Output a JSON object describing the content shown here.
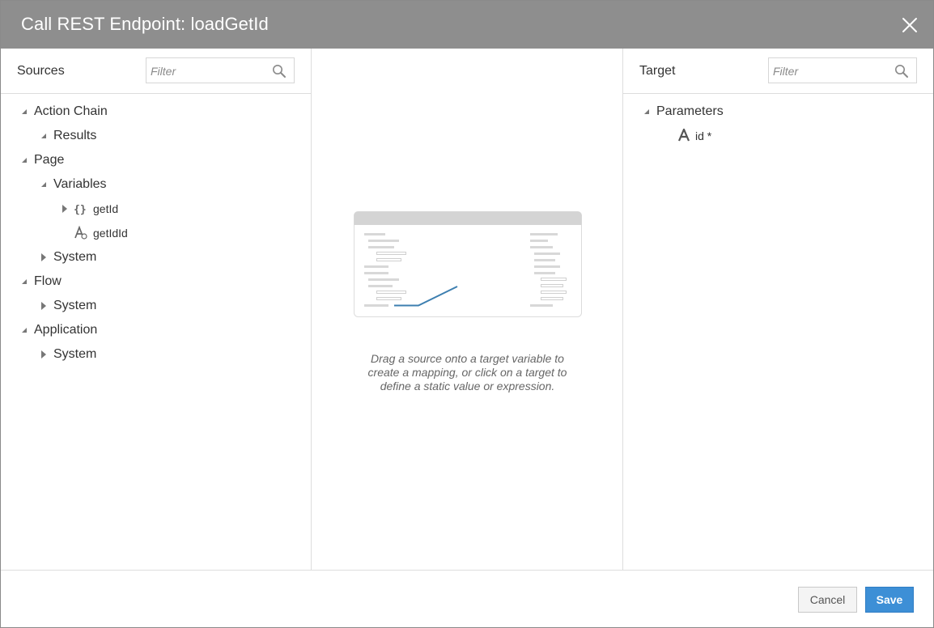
{
  "dialog": {
    "title": "Call REST Endpoint: loadGetId"
  },
  "icons": {
    "close": "close-icon",
    "search": "search-icon",
    "expanded": "triangle-down-icon",
    "collapsed": "triangle-right-icon",
    "object": "curly-braces-icon",
    "string": "string-type-icon"
  },
  "sources": {
    "title": "Sources",
    "filter_placeholder": "Filter",
    "tree": [
      {
        "label": "Action Chain",
        "state": "expanded"
      },
      {
        "label": "Results",
        "state": "expanded"
      },
      {
        "label": "Page",
        "state": "expanded"
      },
      {
        "label": "Variables",
        "state": "expanded"
      },
      {
        "label": "getId",
        "state": "collapsed",
        "type": "object"
      },
      {
        "label": "getIdId",
        "type": "string"
      },
      {
        "label": "System",
        "state": "collapsed"
      },
      {
        "label": "Flow",
        "state": "expanded"
      },
      {
        "label": "System",
        "state": "collapsed"
      },
      {
        "label": "Application",
        "state": "expanded"
      },
      {
        "label": "System",
        "state": "collapsed"
      }
    ]
  },
  "mapping": {
    "hint": "Drag a source onto a target variable to create a mapping, or click on a target to define a static value or expression."
  },
  "target": {
    "title": "Target",
    "filter_placeholder": "Filter",
    "tree": [
      {
        "label": "Parameters",
        "state": "expanded"
      },
      {
        "label": "id *",
        "type": "string"
      }
    ]
  },
  "footer": {
    "cancel_label": "Cancel",
    "save_label": "Save"
  },
  "colors": {
    "titlebar": "#8e8e8e",
    "primary": "#3d8fd6",
    "mapping_line": "#3d7fb0"
  }
}
